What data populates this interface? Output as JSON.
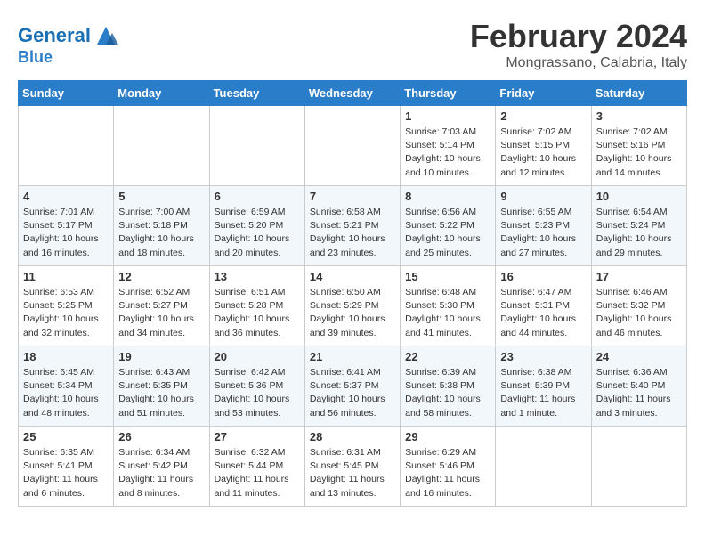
{
  "header": {
    "logo_line1": "General",
    "logo_line2": "Blue",
    "month_title": "February 2024",
    "location": "Mongrassano, Calabria, Italy"
  },
  "weekdays": [
    "Sunday",
    "Monday",
    "Tuesday",
    "Wednesday",
    "Thursday",
    "Friday",
    "Saturday"
  ],
  "weeks": [
    [
      {
        "day": "",
        "info": ""
      },
      {
        "day": "",
        "info": ""
      },
      {
        "day": "",
        "info": ""
      },
      {
        "day": "",
        "info": ""
      },
      {
        "day": "1",
        "info": "Sunrise: 7:03 AM\nSunset: 5:14 PM\nDaylight: 10 hours\nand 10 minutes."
      },
      {
        "day": "2",
        "info": "Sunrise: 7:02 AM\nSunset: 5:15 PM\nDaylight: 10 hours\nand 12 minutes."
      },
      {
        "day": "3",
        "info": "Sunrise: 7:02 AM\nSunset: 5:16 PM\nDaylight: 10 hours\nand 14 minutes."
      }
    ],
    [
      {
        "day": "4",
        "info": "Sunrise: 7:01 AM\nSunset: 5:17 PM\nDaylight: 10 hours\nand 16 minutes."
      },
      {
        "day": "5",
        "info": "Sunrise: 7:00 AM\nSunset: 5:18 PM\nDaylight: 10 hours\nand 18 minutes."
      },
      {
        "day": "6",
        "info": "Sunrise: 6:59 AM\nSunset: 5:20 PM\nDaylight: 10 hours\nand 20 minutes."
      },
      {
        "day": "7",
        "info": "Sunrise: 6:58 AM\nSunset: 5:21 PM\nDaylight: 10 hours\nand 23 minutes."
      },
      {
        "day": "8",
        "info": "Sunrise: 6:56 AM\nSunset: 5:22 PM\nDaylight: 10 hours\nand 25 minutes."
      },
      {
        "day": "9",
        "info": "Sunrise: 6:55 AM\nSunset: 5:23 PM\nDaylight: 10 hours\nand 27 minutes."
      },
      {
        "day": "10",
        "info": "Sunrise: 6:54 AM\nSunset: 5:24 PM\nDaylight: 10 hours\nand 29 minutes."
      }
    ],
    [
      {
        "day": "11",
        "info": "Sunrise: 6:53 AM\nSunset: 5:25 PM\nDaylight: 10 hours\nand 32 minutes."
      },
      {
        "day": "12",
        "info": "Sunrise: 6:52 AM\nSunset: 5:27 PM\nDaylight: 10 hours\nand 34 minutes."
      },
      {
        "day": "13",
        "info": "Sunrise: 6:51 AM\nSunset: 5:28 PM\nDaylight: 10 hours\nand 36 minutes."
      },
      {
        "day": "14",
        "info": "Sunrise: 6:50 AM\nSunset: 5:29 PM\nDaylight: 10 hours\nand 39 minutes."
      },
      {
        "day": "15",
        "info": "Sunrise: 6:48 AM\nSunset: 5:30 PM\nDaylight: 10 hours\nand 41 minutes."
      },
      {
        "day": "16",
        "info": "Sunrise: 6:47 AM\nSunset: 5:31 PM\nDaylight: 10 hours\nand 44 minutes."
      },
      {
        "day": "17",
        "info": "Sunrise: 6:46 AM\nSunset: 5:32 PM\nDaylight: 10 hours\nand 46 minutes."
      }
    ],
    [
      {
        "day": "18",
        "info": "Sunrise: 6:45 AM\nSunset: 5:34 PM\nDaylight: 10 hours\nand 48 minutes."
      },
      {
        "day": "19",
        "info": "Sunrise: 6:43 AM\nSunset: 5:35 PM\nDaylight: 10 hours\nand 51 minutes."
      },
      {
        "day": "20",
        "info": "Sunrise: 6:42 AM\nSunset: 5:36 PM\nDaylight: 10 hours\nand 53 minutes."
      },
      {
        "day": "21",
        "info": "Sunrise: 6:41 AM\nSunset: 5:37 PM\nDaylight: 10 hours\nand 56 minutes."
      },
      {
        "day": "22",
        "info": "Sunrise: 6:39 AM\nSunset: 5:38 PM\nDaylight: 10 hours\nand 58 minutes."
      },
      {
        "day": "23",
        "info": "Sunrise: 6:38 AM\nSunset: 5:39 PM\nDaylight: 11 hours\nand 1 minute."
      },
      {
        "day": "24",
        "info": "Sunrise: 6:36 AM\nSunset: 5:40 PM\nDaylight: 11 hours\nand 3 minutes."
      }
    ],
    [
      {
        "day": "25",
        "info": "Sunrise: 6:35 AM\nSunset: 5:41 PM\nDaylight: 11 hours\nand 6 minutes."
      },
      {
        "day": "26",
        "info": "Sunrise: 6:34 AM\nSunset: 5:42 PM\nDaylight: 11 hours\nand 8 minutes."
      },
      {
        "day": "27",
        "info": "Sunrise: 6:32 AM\nSunset: 5:44 PM\nDaylight: 11 hours\nand 11 minutes."
      },
      {
        "day": "28",
        "info": "Sunrise: 6:31 AM\nSunset: 5:45 PM\nDaylight: 11 hours\nand 13 minutes."
      },
      {
        "day": "29",
        "info": "Sunrise: 6:29 AM\nSunset: 5:46 PM\nDaylight: 11 hours\nand 16 minutes."
      },
      {
        "day": "",
        "info": ""
      },
      {
        "day": "",
        "info": ""
      }
    ]
  ]
}
